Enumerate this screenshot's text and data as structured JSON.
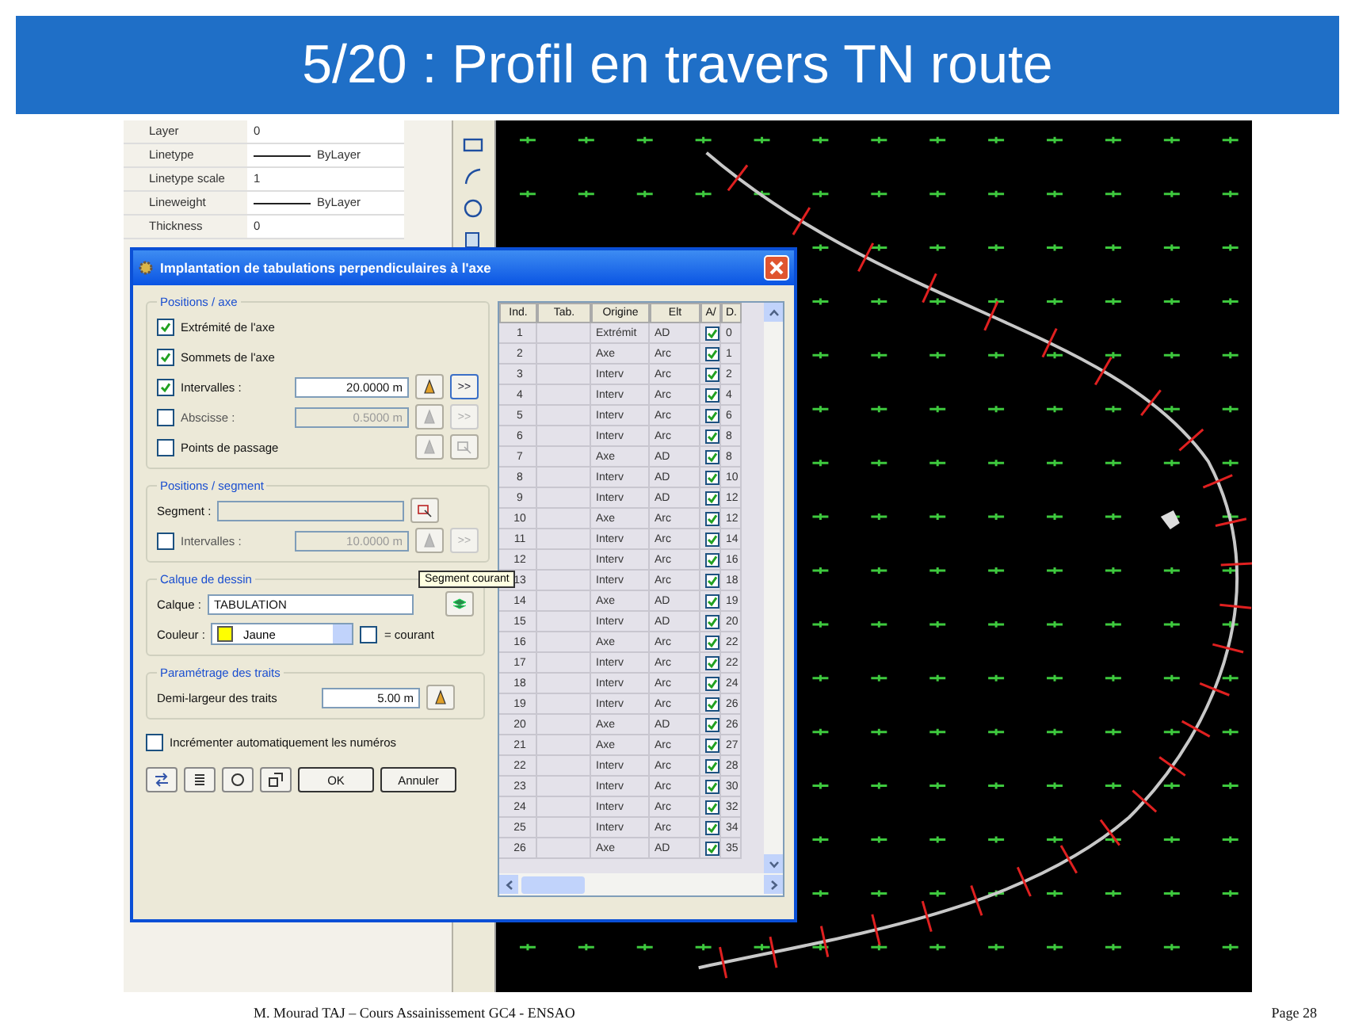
{
  "slide": {
    "title": "5/20 : Profil en travers TN route",
    "footer": "M. Mourad TAJ – Cours Assainissement GC4 - ENSAO",
    "page": "Page   28"
  },
  "properties": [
    {
      "label": "Layer",
      "value": "0",
      "kind": "plain"
    },
    {
      "label": "Linetype",
      "value": "ByLayer",
      "kind": "line"
    },
    {
      "label": "Linetype scale",
      "value": "1",
      "kind": "plain"
    },
    {
      "label": "Lineweight",
      "value": "ByLayer",
      "kind": "line"
    },
    {
      "label": "Thickness",
      "value": "0",
      "kind": "plain"
    }
  ],
  "dialog": {
    "title": "Implantation de tabulations perpendiculaires à l'axe",
    "positions_axe": {
      "title": "Positions / axe",
      "extremite": {
        "label": "Extrémité de l'axe",
        "checked": true
      },
      "sommets": {
        "label": "Sommets de l'axe",
        "checked": true
      },
      "intervalles": {
        "label": "Intervalles :",
        "checked": true,
        "disabled": false,
        "value": "20.0000 m",
        "more": ">>"
      },
      "abscisse": {
        "label": "Abscisse :",
        "checked": false,
        "disabled": true,
        "value": "0.5000 m",
        "more": ">>"
      },
      "points": {
        "label": "Points de passage",
        "checked": false,
        "disabled": false
      }
    },
    "positions_segment": {
      "title": "Positions / segment",
      "segment_label": "Segment :",
      "tooltip": "Segment courant",
      "intervalles": {
        "label": "Intervalles :",
        "checked": false,
        "disabled": true,
        "value": "10.0000 m",
        "more": ">>"
      }
    },
    "calque": {
      "title": "Calque de dessin",
      "calque_label": "Calque :",
      "calque_value": "TABULATION",
      "couleur_label": "Couleur :",
      "couleur_value": "Jaune",
      "color": "#ffff00",
      "courant": {
        "label": "= courant",
        "checked": false
      }
    },
    "traits": {
      "title": "Paramétrage des traits",
      "label": "Demi-largeur des traits",
      "value": "5.00 m"
    },
    "incrementer": {
      "label": "Incrémenter automatiquement les numéros",
      "checked": false
    },
    "buttons": [
      "OK",
      "Annuler"
    ],
    "table": {
      "columns": [
        "Ind.",
        "Tab.",
        "Origine",
        "Elt",
        "A/",
        "D."
      ],
      "rows": [
        {
          "ind": "1",
          "tab": "",
          "origine": "Extrémit",
          "elt": "AD",
          "checked": true,
          "d": "0"
        },
        {
          "ind": "2",
          "tab": "",
          "origine": "Axe",
          "elt": "Arc",
          "checked": true,
          "d": "1"
        },
        {
          "ind": "3",
          "tab": "",
          "origine": "Interv",
          "elt": "Arc",
          "checked": true,
          "d": "2"
        },
        {
          "ind": "4",
          "tab": "",
          "origine": "Interv",
          "elt": "Arc",
          "checked": true,
          "d": "4"
        },
        {
          "ind": "5",
          "tab": "",
          "origine": "Interv",
          "elt": "Arc",
          "checked": true,
          "d": "6"
        },
        {
          "ind": "6",
          "tab": "",
          "origine": "Interv",
          "elt": "Arc",
          "checked": true,
          "d": "8"
        },
        {
          "ind": "7",
          "tab": "",
          "origine": "Axe",
          "elt": "AD",
          "checked": true,
          "d": "8"
        },
        {
          "ind": "8",
          "tab": "",
          "origine": "Interv",
          "elt": "AD",
          "checked": true,
          "d": "10"
        },
        {
          "ind": "9",
          "tab": "",
          "origine": "Interv",
          "elt": "AD",
          "checked": true,
          "d": "12"
        },
        {
          "ind": "10",
          "tab": "",
          "origine": "Axe",
          "elt": "Arc",
          "checked": true,
          "d": "12"
        },
        {
          "ind": "11",
          "tab": "",
          "origine": "Interv",
          "elt": "Arc",
          "checked": true,
          "d": "14"
        },
        {
          "ind": "12",
          "tab": "",
          "origine": "Interv",
          "elt": "Arc",
          "checked": true,
          "d": "16"
        },
        {
          "ind": "13",
          "tab": "",
          "origine": "Interv",
          "elt": "Arc",
          "checked": true,
          "d": "18"
        },
        {
          "ind": "14",
          "tab": "",
          "origine": "Axe",
          "elt": "AD",
          "checked": true,
          "d": "19"
        },
        {
          "ind": "15",
          "tab": "",
          "origine": "Interv",
          "elt": "AD",
          "checked": true,
          "d": "20"
        },
        {
          "ind": "16",
          "tab": "",
          "origine": "Axe",
          "elt": "Arc",
          "checked": true,
          "d": "22"
        },
        {
          "ind": "17",
          "tab": "",
          "origine": "Interv",
          "elt": "Arc",
          "checked": true,
          "d": "22"
        },
        {
          "ind": "18",
          "tab": "",
          "origine": "Interv",
          "elt": "Arc",
          "checked": true,
          "d": "24"
        },
        {
          "ind": "19",
          "tab": "",
          "origine": "Interv",
          "elt": "Arc",
          "checked": true,
          "d": "26"
        },
        {
          "ind": "20",
          "tab": "",
          "origine": "Axe",
          "elt": "AD",
          "checked": true,
          "d": "26"
        },
        {
          "ind": "21",
          "tab": "",
          "origine": "Axe",
          "elt": "Arc",
          "checked": true,
          "d": "27"
        },
        {
          "ind": "22",
          "tab": "",
          "origine": "Interv",
          "elt": "Arc",
          "checked": true,
          "d": "28"
        },
        {
          "ind": "23",
          "tab": "",
          "origine": "Interv",
          "elt": "Arc",
          "checked": true,
          "d": "30"
        },
        {
          "ind": "24",
          "tab": "",
          "origine": "Interv",
          "elt": "Arc",
          "checked": true,
          "d": "32"
        },
        {
          "ind": "25",
          "tab": "",
          "origine": "Interv",
          "elt": "Arc",
          "checked": true,
          "d": "34"
        },
        {
          "ind": "26",
          "tab": "",
          "origine": "Axe",
          "elt": "AD",
          "checked": true,
          "d": "35"
        }
      ]
    }
  }
}
